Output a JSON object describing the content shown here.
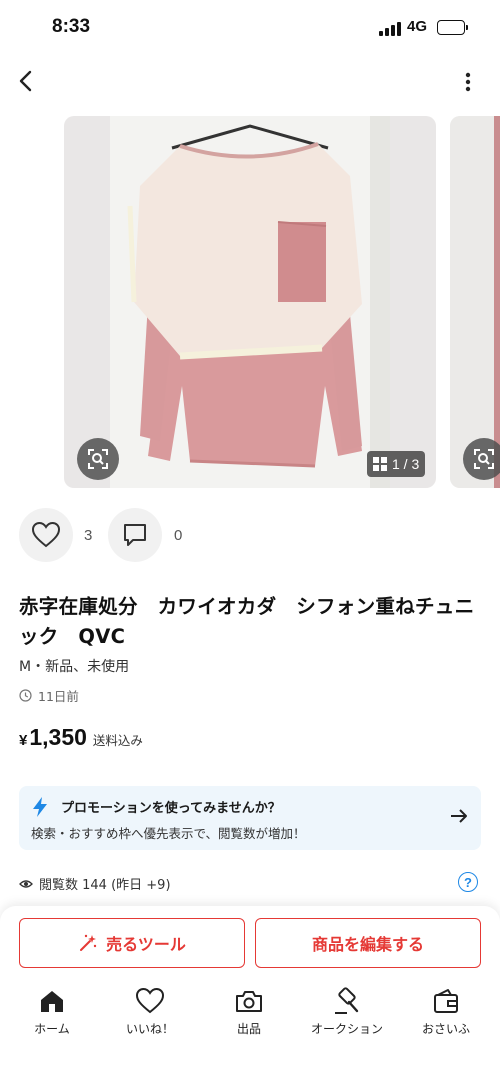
{
  "status_bar": {
    "time": "8:33",
    "network": "4G"
  },
  "gallery": {
    "counter": "1 / 3"
  },
  "reactions": {
    "likes": "3",
    "comments": "0"
  },
  "item": {
    "title": "赤字在庫処分　カワイオカダ　シフォン重ねチュニック　QVC",
    "condition": "M・新品、未使用",
    "posted": "11日前",
    "currency": "¥",
    "price": "1,350",
    "shipping": "送料込み"
  },
  "promo": {
    "title": "プロモーションを使ってみませんか？",
    "description": "検索・おすすめ枠へ優先表示で、閲覧数が増加！"
  },
  "stats": {
    "views": "閲覧数  144 (昨日 +9)"
  },
  "actions": {
    "sell_tools": "売るツール",
    "edit_item": "商品を編集する"
  },
  "tabs": [
    {
      "label": "ホーム",
      "icon": "home-icon"
    },
    {
      "label": "いいね！",
      "icon": "heart-icon"
    },
    {
      "label": "出品",
      "icon": "camera-icon"
    },
    {
      "label": "オークション",
      "icon": "gavel-icon"
    },
    {
      "label": "おさいふ",
      "icon": "wallet-icon"
    }
  ],
  "colors": {
    "accent": "#e53935",
    "bolt": "#1e88e5",
    "promo_bg": "#eef6fc"
  }
}
